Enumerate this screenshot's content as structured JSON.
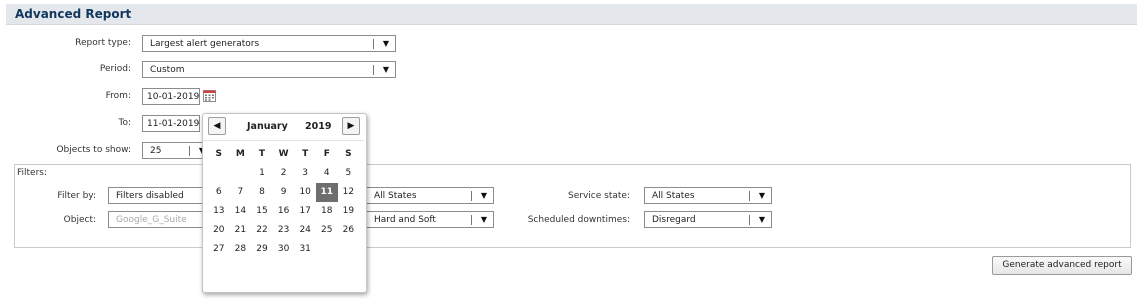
{
  "page": {
    "title": "Advanced Report"
  },
  "form": {
    "report_type": {
      "label": "Report type:",
      "value": "Largest alert generators"
    },
    "period": {
      "label": "Period:",
      "value": "Custom"
    },
    "from": {
      "label": "From:",
      "value": "10-01-2019"
    },
    "to": {
      "label": "To:",
      "value": "11-01-2019"
    },
    "objects": {
      "label": "Objects to show:",
      "value": "25"
    }
  },
  "filters": {
    "title": "Filters:",
    "filter_by": {
      "label": "Filter by:",
      "value": "Filters disabled"
    },
    "object": {
      "label": "Object:",
      "placeholder": "Google_G_Suite"
    },
    "state": {
      "value": "All States"
    },
    "state_type": {
      "value": "Hard and Soft"
    },
    "service_state": {
      "label": "Service state:",
      "value": "All States"
    },
    "scheduled_downtimes": {
      "label": "Scheduled downtimes:",
      "value": "Disregard"
    }
  },
  "generate_button": "Generate advanced report",
  "datepicker": {
    "month": "January",
    "year": "2019",
    "prev_icon": "◀",
    "next_icon": "▶",
    "weekdays": [
      "S",
      "M",
      "T",
      "W",
      "T",
      "F",
      "S"
    ],
    "weeks": [
      [
        "",
        "",
        "1",
        "2",
        "3",
        "4",
        "5"
      ],
      [
        "6",
        "7",
        "8",
        "9",
        "10",
        "11",
        "12"
      ],
      [
        "13",
        "14",
        "15",
        "16",
        "17",
        "18",
        "19"
      ],
      [
        "20",
        "21",
        "22",
        "23",
        "24",
        "25",
        "26"
      ],
      [
        "27",
        "28",
        "29",
        "30",
        "31",
        "",
        ""
      ]
    ],
    "selected_day": "11"
  },
  "icons": {
    "dropdown": "▼",
    "calendar": "calendar-icon"
  }
}
